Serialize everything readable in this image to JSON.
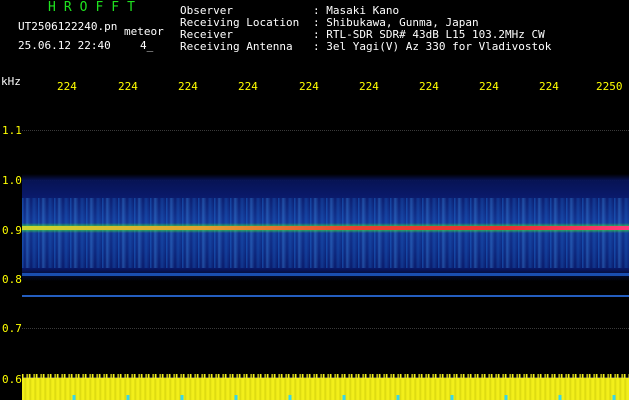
{
  "header": {
    "title": "HROFFT",
    "filename": "UT2506122240.pn",
    "mode": "meteor",
    "datetime": "25.06.12 22:40",
    "counter": "4_"
  },
  "station_info": [
    {
      "label": "Observer",
      "value": ": Masaki Kano"
    },
    {
      "label": "Receiving Location",
      "value": ": Shibukawa, Gunma, Japan"
    },
    {
      "label": "Receiver",
      "value": ": RTL-SDR SDR# 43dB L15 103.2MHz CW"
    },
    {
      "label": "Receiving Antenna",
      "value": ": 3el Yagi(V) Az 330 for Vladivostok"
    }
  ],
  "axes": {
    "unit": "kHz",
    "time_ticks": [
      "224",
      "224",
      "224",
      "224",
      "224",
      "224",
      "224",
      "224",
      "224",
      "2250"
    ],
    "freq_ticks": [
      "1.1",
      "1.0",
      "0.9",
      "0.8",
      "0.7",
      "0.6"
    ]
  },
  "colors": {
    "noise_low": "#0a1a6e",
    "noise_mid": "#1f6fd6",
    "carrier": "#e83030",
    "carrier_edge": "#39e639",
    "amplitude_bar": "#f2ef1a",
    "label_yellow": "#ffff00",
    "title_green": "#1fe21f"
  }
}
